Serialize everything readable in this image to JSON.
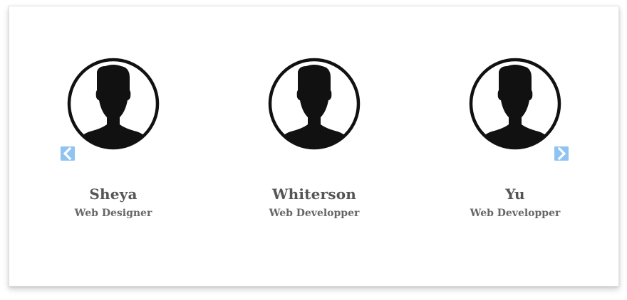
{
  "carousel": {
    "prev_icon": "chevron-left-icon",
    "next_icon": "chevron-right-icon",
    "arrow_color": "#8fc3f2",
    "members": [
      {
        "name": "Sheya",
        "role": "Web Designer",
        "avatar_icon": "user-silhouette-icon"
      },
      {
        "name": "Whiterson",
        "role": "Web Developper",
        "avatar_icon": "user-silhouette-icon"
      },
      {
        "name": "Yu",
        "role": "Web Developper",
        "avatar_icon": "user-silhouette-icon"
      }
    ]
  },
  "colors": {
    "name_text": "#555555",
    "role_text": "#666666",
    "avatar": "#111111"
  }
}
